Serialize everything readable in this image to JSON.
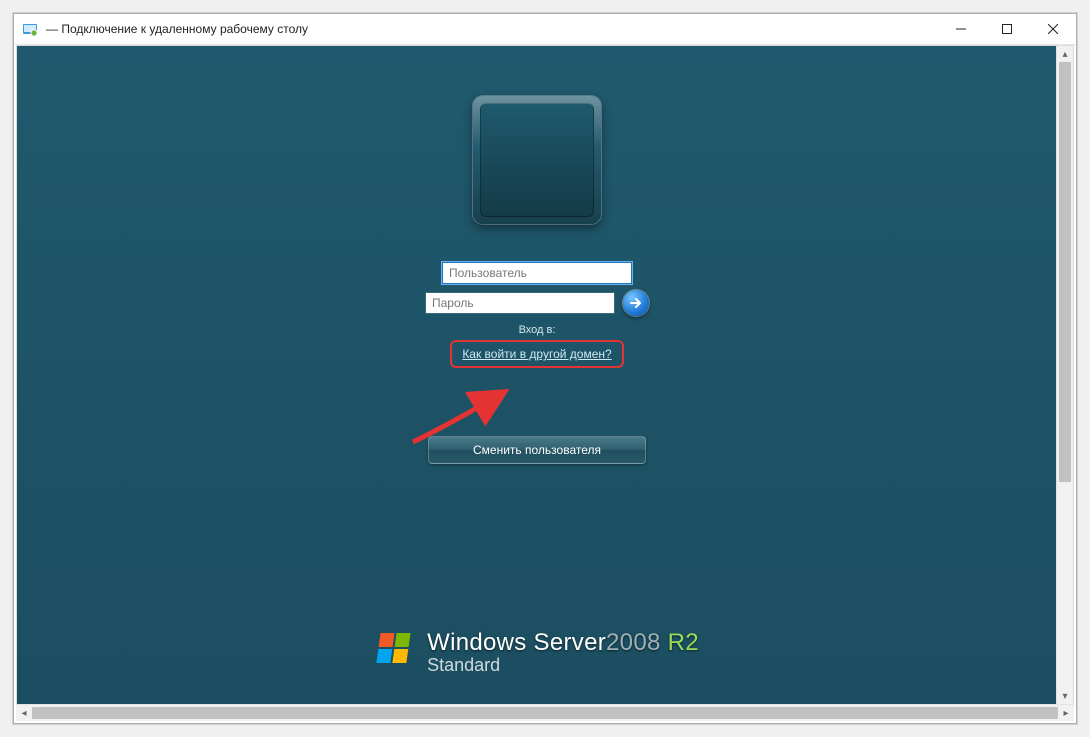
{
  "window": {
    "title": "— Подключение к удаленному рабочему столу"
  },
  "login": {
    "username_placeholder": "Пользователь",
    "password_placeholder": "Пароль",
    "login_to_label": "Вход в:",
    "domain_link": "Как войти в другой домен?",
    "switch_user": "Сменить пользователя"
  },
  "branding": {
    "product": "Windows Server",
    "year": "2008",
    "r2": "R2",
    "edition": "Standard"
  }
}
